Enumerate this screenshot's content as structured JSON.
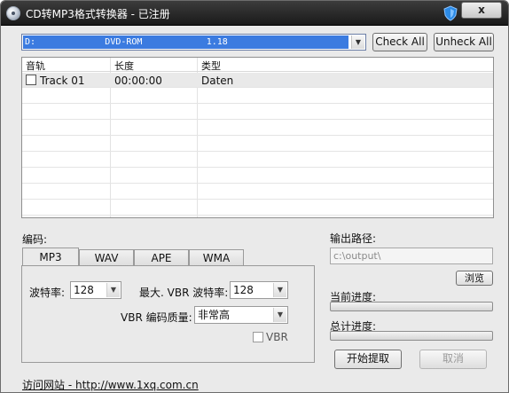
{
  "window": {
    "title": "CD转MP3格式转换器 - 已注册",
    "close_label": "x"
  },
  "drive": {
    "selected": "D:             DVD-ROM            1.18"
  },
  "buttons": {
    "check_all": "Check All",
    "uncheck_all": "Unheck All",
    "browse": "浏览",
    "start": "开始提取",
    "cancel": "取消"
  },
  "track_list": {
    "columns": [
      "音轨",
      "长度",
      "类型"
    ],
    "rows": [
      {
        "checked": false,
        "track": "Track 01",
        "length": "00:00:00",
        "type": "Daten"
      }
    ]
  },
  "encoding": {
    "label": "编码:",
    "tabs": [
      "MP3",
      "WAV",
      "APE",
      "WMA"
    ],
    "active_tab": "MP3",
    "bitrate_label": "波特率:",
    "bitrate_value": "128",
    "max_vbr_label": "最大. VBR 波特率:",
    "max_vbr_value": "128",
    "vbr_quality_label": "VBR 编码质量:",
    "vbr_quality_value": "非常高",
    "vbr_checkbox_label": "VBR",
    "vbr_checked": false
  },
  "output": {
    "label": "输出路径:",
    "path": "c:\\output\\"
  },
  "progress": {
    "current_label": "当前进度:",
    "current_value": 0,
    "total_label": "总计进度:",
    "total_value": 0
  },
  "footer": {
    "link_text": "访问网站 - http://www.1xq.com.cn"
  },
  "colors": {
    "selection": "#3b7be0",
    "progress_fill": "#5fb356"
  }
}
